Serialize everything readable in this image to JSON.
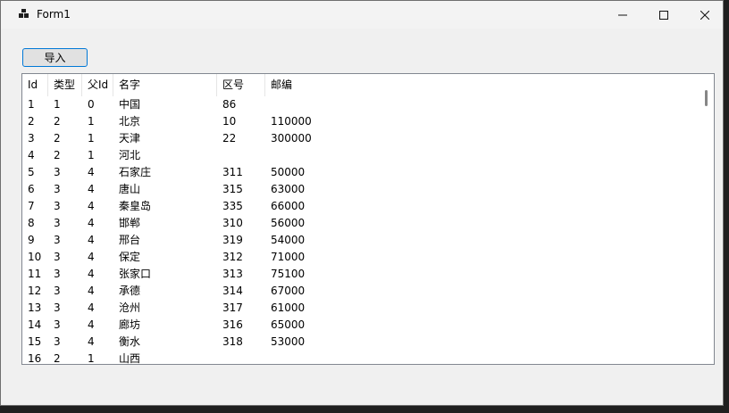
{
  "window": {
    "title": "Form1"
  },
  "toolbar": {
    "import_label": "导入"
  },
  "table": {
    "headers": [
      "Id",
      "类型",
      "父Id",
      "名字",
      "区号",
      "邮编"
    ],
    "rows": [
      [
        "1",
        "1",
        "0",
        "中国",
        "86",
        ""
      ],
      [
        "2",
        "2",
        "1",
        "北京",
        "10",
        "110000"
      ],
      [
        "3",
        "2",
        "1",
        "天津",
        "22",
        "300000"
      ],
      [
        "4",
        "2",
        "1",
        "河北",
        "",
        ""
      ],
      [
        "5",
        "3",
        "4",
        "石家庄",
        "311",
        "50000"
      ],
      [
        "6",
        "3",
        "4",
        "唐山",
        "315",
        "63000"
      ],
      [
        "7",
        "3",
        "4",
        "秦皇岛",
        "335",
        "66000"
      ],
      [
        "8",
        "3",
        "4",
        "邯郸",
        "310",
        "56000"
      ],
      [
        "9",
        "3",
        "4",
        "邢台",
        "319",
        "54000"
      ],
      [
        "10",
        "3",
        "4",
        "保定",
        "312",
        "71000"
      ],
      [
        "11",
        "3",
        "4",
        "张家口",
        "313",
        "75100"
      ],
      [
        "12",
        "3",
        "4",
        "承德",
        "314",
        "67000"
      ],
      [
        "13",
        "3",
        "4",
        "沧州",
        "317",
        "61000"
      ],
      [
        "14",
        "3",
        "4",
        "廊坊",
        "316",
        "65000"
      ],
      [
        "15",
        "3",
        "4",
        "衡水",
        "318",
        "53000"
      ],
      [
        "16",
        "2",
        "1",
        "山西",
        "",
        ""
      ]
    ]
  },
  "colors": {
    "button_border": "#0078d7",
    "window_bg": "#f0f0f0"
  },
  "icons": {
    "app": "app-icon",
    "minimize": "minimize-icon",
    "maximize": "maximize-icon",
    "close": "close-icon"
  }
}
